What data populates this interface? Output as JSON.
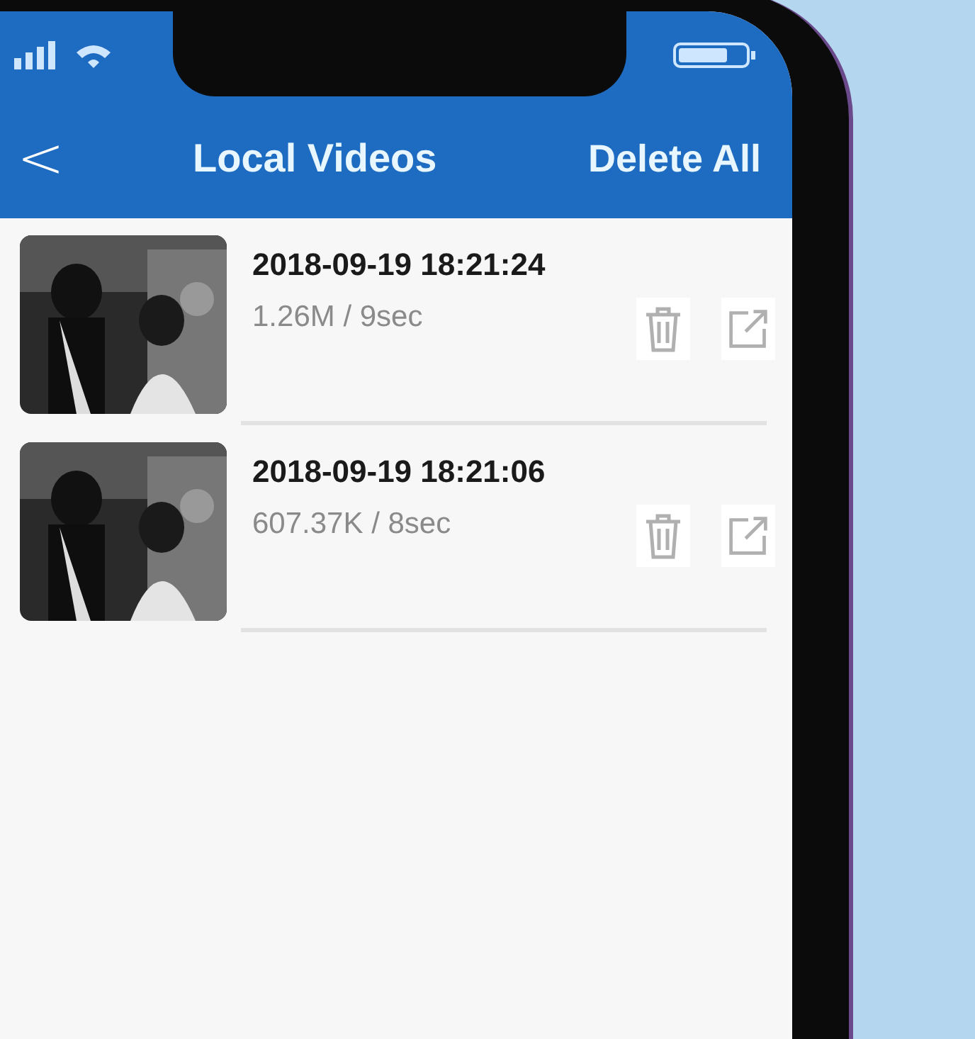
{
  "nav": {
    "back": "<",
    "title": "Local Videos",
    "action": "Delete All"
  },
  "videos": [
    {
      "kind": "picture",
      "title": "2018-09-19 18:21:24",
      "meta": "1.26M / 9sec"
    },
    {
      "kind": "picture",
      "title": "2018-09-19 18:21:06",
      "meta": "607.37K / 8sec"
    }
  ]
}
